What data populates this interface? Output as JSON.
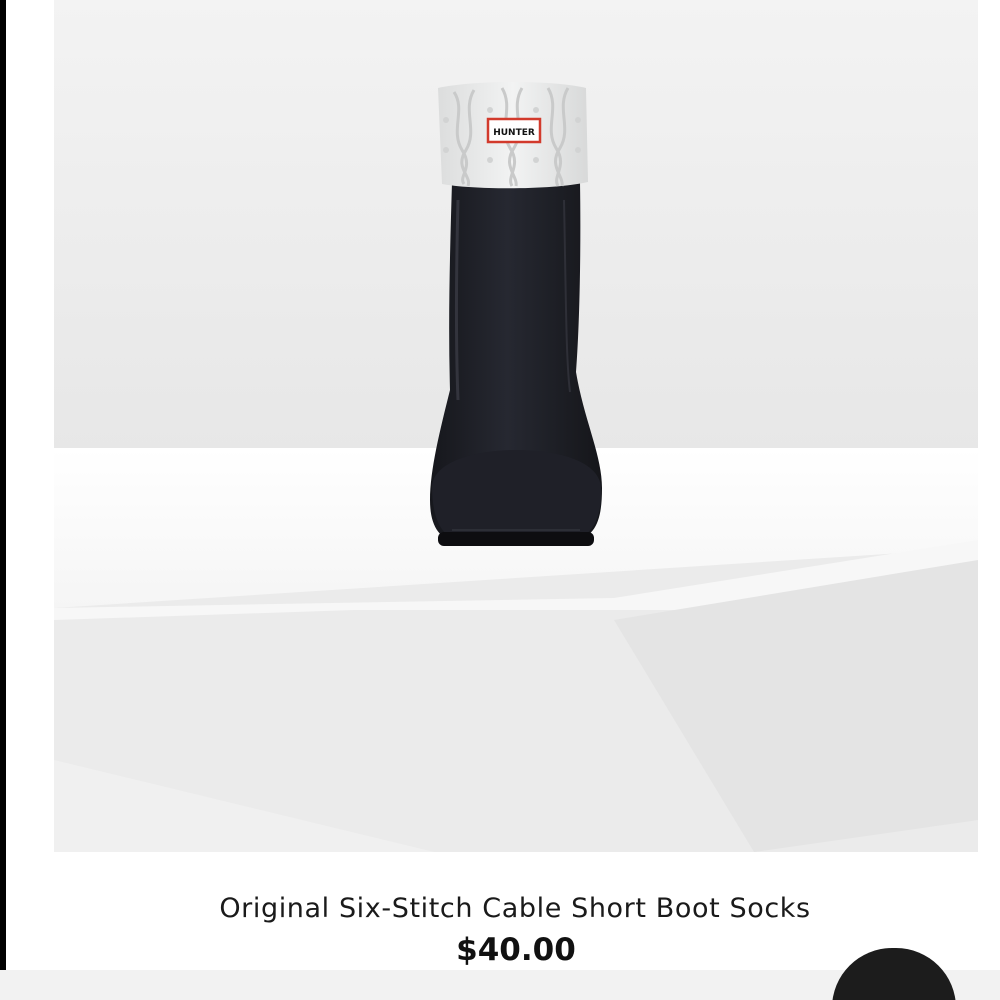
{
  "product": {
    "title": "Original Six-Stitch Cable Short Boot Socks",
    "price": "$40.00",
    "brand_label": "HUNTER"
  },
  "colors": {
    "boot": "#1e1f26",
    "sock": "#e9eaea",
    "brand_label_border": "#d23a2c",
    "background": "#ededed"
  },
  "icons": {
    "fab": "circle-button"
  }
}
